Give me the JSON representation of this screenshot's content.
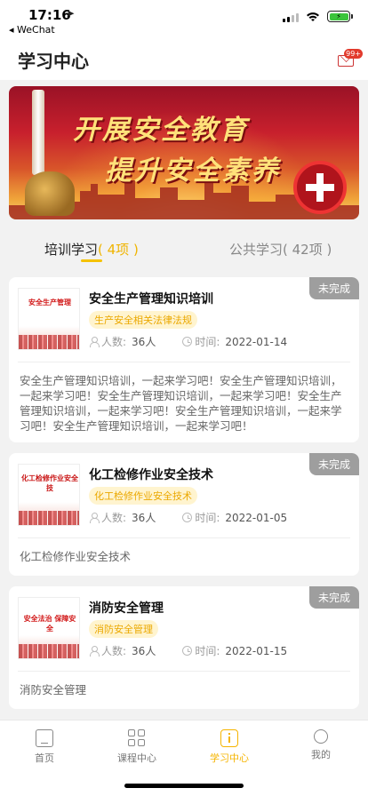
{
  "status_bar": {
    "time": "17:16",
    "back_app": "◂ WeChat",
    "battery_color": "#3ac43a"
  },
  "header": {
    "title": "学习中心",
    "message_badge": "99+",
    "message_icon": "mail-icon"
  },
  "banner": {
    "line1": "开展安全教育",
    "line2": "提升安全素养"
  },
  "tabs": [
    {
      "label": "培训学习",
      "count": "( 4项 )",
      "active": true
    },
    {
      "label": "公共学习",
      "count": "( 42项 )",
      "active": false
    }
  ],
  "courses": [
    {
      "title": "安全生产管理知识培训",
      "status": "未完成",
      "tag": "生产安全相关法律法规",
      "people_label": "人数:",
      "people": "36人",
      "time_label": "时间:",
      "date": "2022-01-14",
      "thumb_text": "安全生产管理",
      "description": "安全生产管理知识培训，一起来学习吧！安全生产管理知识培训，一起来学习吧！安全生产管理知识培训，一起来学习吧！安全生产管理知识培训，一起来学习吧！安全生产管理知识培训，一起来学习吧！安全生产管理知识培训，一起来学习吧！"
    },
    {
      "title": "化工检修作业安全技术",
      "status": "未完成",
      "tag": "化工检修作业安全技术",
      "people_label": "人数:",
      "people": "36人",
      "time_label": "时间:",
      "date": "2022-01-05",
      "thumb_text": "化工检修作业安全技",
      "description": "化工检修作业安全技术"
    },
    {
      "title": "消防安全管理",
      "status": "未完成",
      "tag": "消防安全管理",
      "people_label": "人数:",
      "people": "36人",
      "time_label": "时间:",
      "date": "2022-01-15",
      "thumb_text": "安全法治 保障安全",
      "description": "消防安全管理"
    }
  ],
  "tabbar": [
    {
      "label": "首页",
      "icon": "home-icon",
      "active": false
    },
    {
      "label": "课程中心",
      "icon": "grid-icon",
      "active": false
    },
    {
      "label": "学习中心",
      "icon": "study-icon",
      "active": true
    },
    {
      "label": "我的",
      "icon": "user-icon",
      "active": false
    }
  ],
  "colors": {
    "accent": "#f5c200",
    "status_gray": "#9e9e9e",
    "tag_bg": "#fff4cf",
    "tag_text": "#eba800"
  }
}
